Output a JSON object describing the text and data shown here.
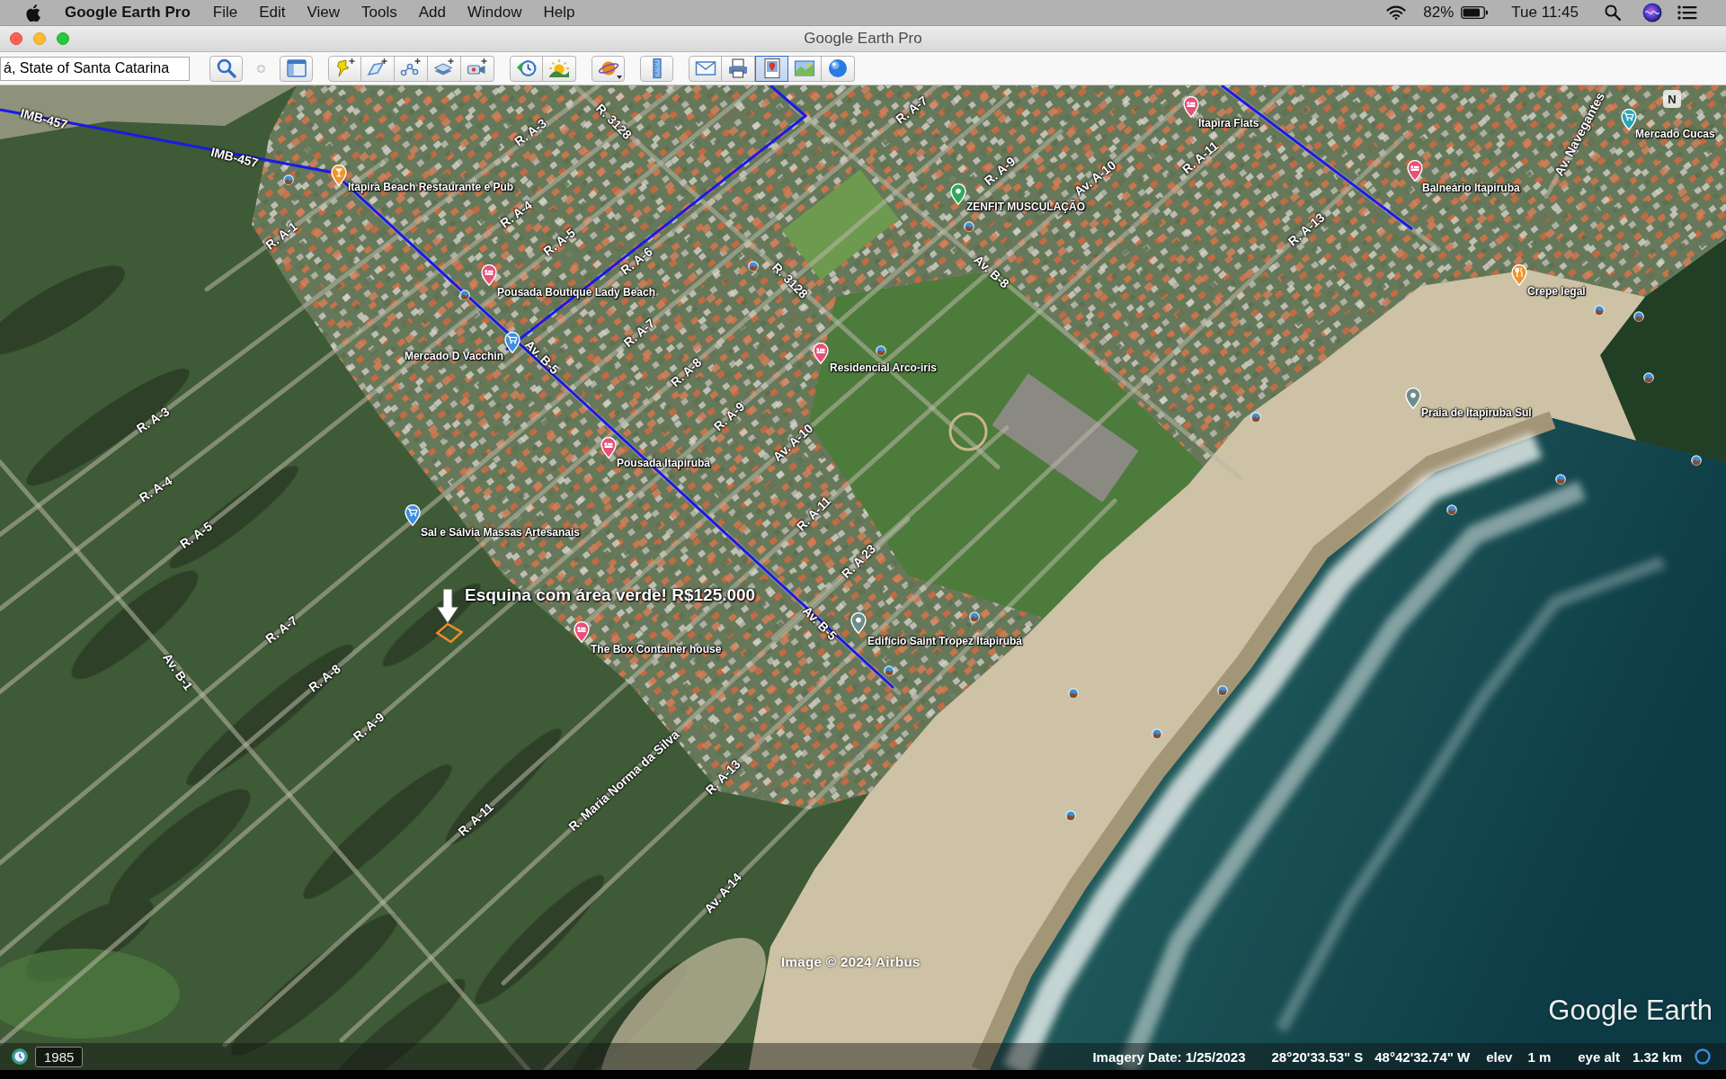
{
  "menu_bar": {
    "app_name": "Google Earth Pro",
    "menus": [
      "File",
      "Edit",
      "View",
      "Tools",
      "Add",
      "Window",
      "Help"
    ],
    "battery": "82%",
    "clock": "Tue 11:45"
  },
  "window": {
    "title": "Google Earth Pro"
  },
  "toolbar": {
    "search_field": {
      "value": "á, State of Santa Catarina"
    },
    "groups": [
      {
        "buttons": [
          {
            "kind": "search",
            "pressed": false
          }
        ]
      },
      {
        "buttons": [
          {
            "kind": "sidebar",
            "pressed": false
          }
        ]
      },
      {
        "buttons": [
          {
            "kind": "placemark",
            "pressed": false
          },
          {
            "kind": "polygon",
            "pressed": false
          },
          {
            "kind": "path",
            "pressed": false
          },
          {
            "kind": "overlay",
            "pressed": false
          },
          {
            "kind": "tour",
            "pressed": false
          }
        ]
      },
      {
        "buttons": [
          {
            "kind": "history",
            "pressed": false
          },
          {
            "kind": "sun",
            "pressed": false
          }
        ]
      },
      {
        "buttons": [
          {
            "kind": "planet",
            "pressed": false
          }
        ]
      },
      {
        "buttons": [
          {
            "kind": "ruler",
            "pressed": false
          }
        ]
      },
      {
        "buttons": [
          {
            "kind": "email",
            "pressed": false
          },
          {
            "kind": "print",
            "pressed": false
          },
          {
            "kind": "image",
            "pressed": true
          },
          {
            "kind": "maps",
            "pressed": false
          },
          {
            "kind": "globe",
            "pressed": false
          }
        ]
      }
    ]
  },
  "map": {
    "compass": "N",
    "places": [
      {
        "name": "Itapira Flats",
        "kind": "hotel",
        "color": "#e8507a"
      },
      {
        "name": "Mercado Cucas",
        "kind": "shop",
        "color": "#26a6b8"
      },
      {
        "name": "Itapira Beach Restaurante e Pub",
        "kind": "bar",
        "color": "#f0942e"
      },
      {
        "name": "Balneário Itapiruba",
        "kind": "hotel",
        "color": "#e8507a"
      },
      {
        "name": "ZENFIT MUSCULAÇÃO",
        "kind": "place",
        "color": "#2fa85a"
      },
      {
        "name": "Crepe legal",
        "kind": "restaurant",
        "color": "#f0942e"
      },
      {
        "name": "Pousada Boutique Lady Beach",
        "kind": "hotel",
        "color": "#e8507a"
      },
      {
        "name": "Mercado D Vacchin",
        "kind": "shop",
        "color": "#3e8ede"
      },
      {
        "name": "Residencial Arco-iris",
        "kind": "hotel",
        "color": "#e8507a"
      },
      {
        "name": "Praia de Itapiruba Sul",
        "kind": "place",
        "color": "#6f8c8c"
      },
      {
        "name": "Pousada Itapiruba",
        "kind": "hotel",
        "color": "#e8507a"
      },
      {
        "name": "Sal e Sálvia Massas Artesanais",
        "kind": "shop",
        "color": "#3e8ede"
      },
      {
        "name": "Edifício Saint Tropez Itapirubá",
        "kind": "place",
        "color": "#6f8c8c"
      },
      {
        "name": "The Box Container house",
        "kind": "hotel",
        "color": "#e8507a"
      }
    ],
    "roads": [
      "IMB-457",
      "IMB-457",
      "R. A-3",
      "R. 3128",
      "R. A-1",
      "R. A-4",
      "R. A-5",
      "R. A-6",
      "R. 3128",
      "Av. B-5",
      "R. A-7",
      "R. A-8",
      "R. A-9",
      "Av. A-10",
      "R. A-11",
      "R. A 23",
      "Av. B-5",
      "R. A-7",
      "R. A-9",
      "Av. A-10",
      "R. A-11",
      "Av. B-8",
      "R. A-13",
      "Av. Navegantes",
      "R. A-3",
      "R. A-4",
      "R. A-5",
      "Av. B-1",
      "R. A-7",
      "R. A-8",
      "R. A-9",
      "R. A-11",
      "R. Maria Norma da Silva",
      "R. A-13",
      "Av. A-14"
    ],
    "listing": {
      "label": "Esquina com área verde! R$125.000"
    },
    "attribution": "Image © 2024 Airbus",
    "logo": "Google Earth"
  },
  "status_bar": {
    "year": "1985",
    "imagery_date": "Imagery Date: 1/25/2023",
    "latitude": "28°20'33.53\" S",
    "longitude": "48°42'32.74\" W",
    "elev_label": "elev",
    "elev_value": "1 m",
    "eye_alt_label": "eye alt",
    "eye_alt_value": "1.32 km"
  }
}
